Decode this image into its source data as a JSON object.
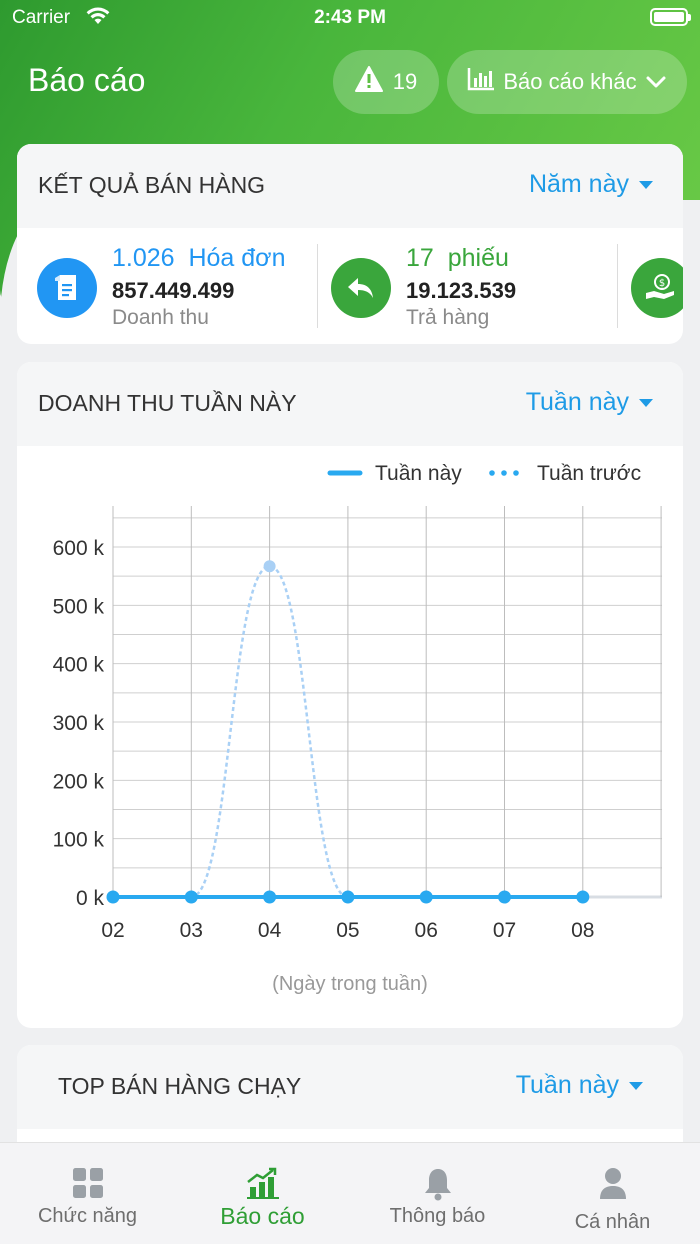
{
  "status_bar": {
    "carrier": "Carrier",
    "time": "2:43 PM"
  },
  "header": {
    "title": "Báo cáo",
    "alert_count": "19",
    "other_reports_label": "Báo cáo khác"
  },
  "sales_result": {
    "title": "KẾT QUẢ BÁN HÀNG",
    "period": "Năm này",
    "kpis": [
      {
        "count": "1.026",
        "unit": "Hóa đơn",
        "value": "857.449.499",
        "label": "Doanh thu",
        "color": "#2196f3"
      },
      {
        "count": "17",
        "unit": "phiếu",
        "value": "19.123.539",
        "label": "Trả hàng",
        "color": "#3aa63c"
      }
    ]
  },
  "weekly_revenue": {
    "title": "DOANH THU TUẦN NÀY",
    "period": "Tuần này",
    "legend": {
      "current": "Tuần này",
      "previous": "Tuần trước"
    },
    "x_axis_label": "(Ngày trong tuần)"
  },
  "chart_data": {
    "type": "line",
    "title": "DOANH THU TUẦN NÀY",
    "xlabel": "(Ngày trong tuần)",
    "ylabel": "",
    "categories": [
      "02",
      "03",
      "04",
      "05",
      "06",
      "07",
      "08"
    ],
    "y_ticks": [
      "0 k",
      "100 k",
      "200 k",
      "300 k",
      "400 k",
      "500 k",
      "600 k"
    ],
    "ylim": [
      0,
      600
    ],
    "series": [
      {
        "name": "Tuần này",
        "style": "solid",
        "color": "#29a9f0",
        "values": [
          0,
          0,
          0,
          0,
          0,
          0,
          0
        ]
      },
      {
        "name": "Tuần trước",
        "style": "dotted",
        "color": "#a9d0f5",
        "values": [
          0,
          0,
          567,
          0,
          null,
          null,
          null
        ]
      }
    ],
    "grid": true,
    "legend_position": "top-right"
  },
  "top_selling": {
    "title": "TOP BÁN HÀNG CHẠY",
    "period": "Tuần này"
  },
  "tabbar": {
    "active_color": "#2f9e35",
    "items": [
      {
        "label": "Chức năng"
      },
      {
        "label": "Báo cáo"
      },
      {
        "label": "Thông báo"
      },
      {
        "label": "Cá nhân"
      }
    ]
  }
}
